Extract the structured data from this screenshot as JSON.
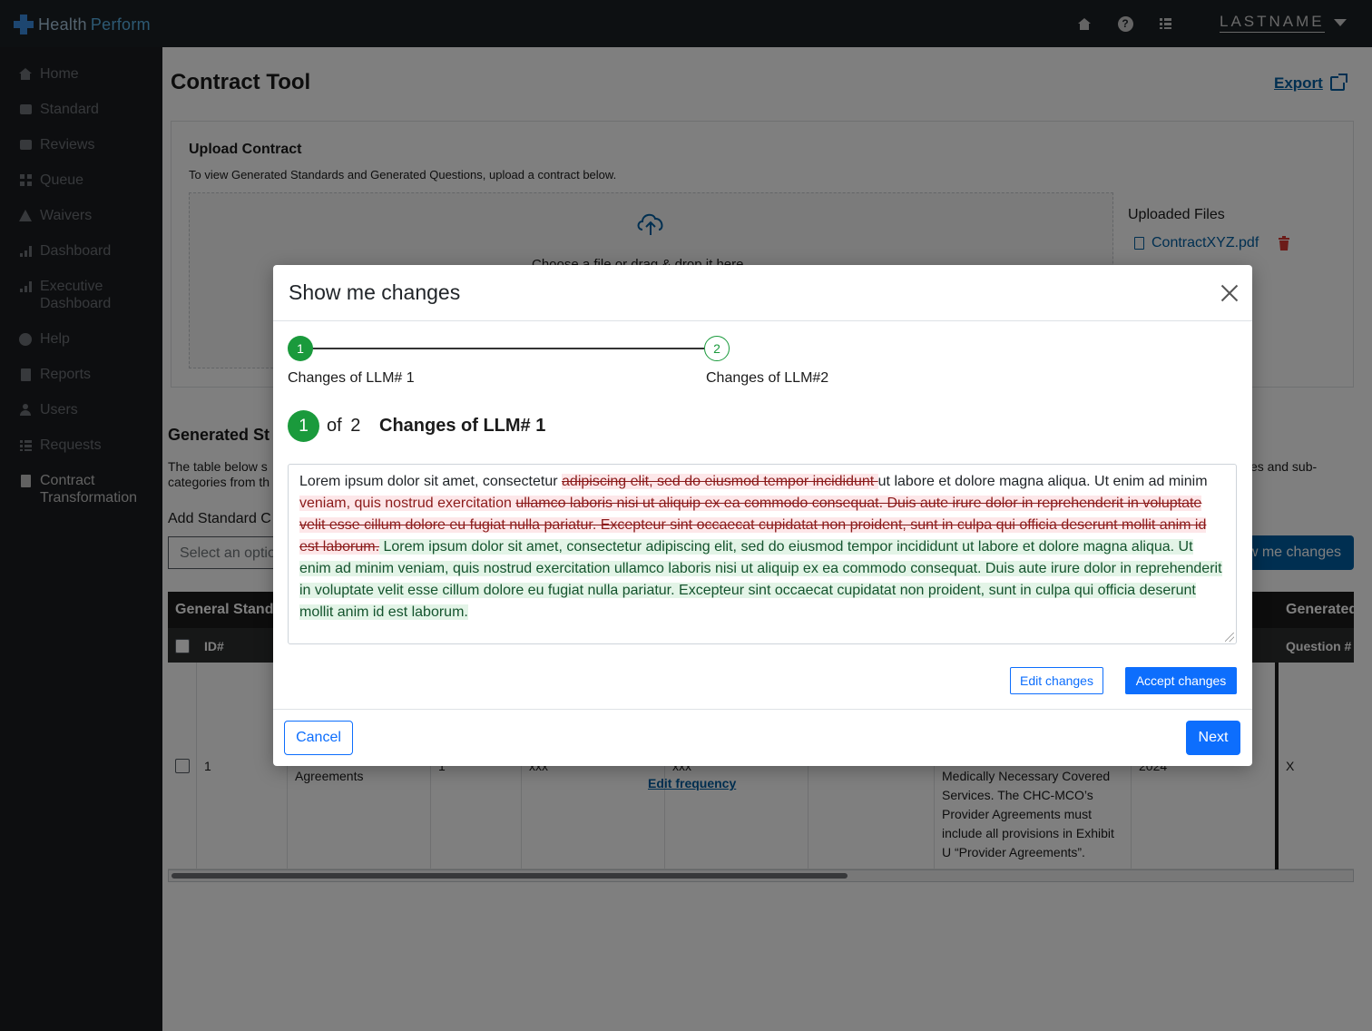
{
  "app": {
    "logo_part1": "Health",
    "logo_part2": "Perform",
    "user_name": "LASTNAME"
  },
  "topbar_icons": [
    "home-icon",
    "help-icon",
    "checklist-icon"
  ],
  "sidebar": {
    "items": [
      {
        "label": "Home",
        "icon": "home-icon"
      },
      {
        "label": "Standard",
        "icon": "book-icon"
      },
      {
        "label": "Reviews",
        "icon": "briefcase-icon"
      },
      {
        "label": "Queue",
        "icon": "grid-icon"
      },
      {
        "label": "Waivers",
        "icon": "warning-icon"
      },
      {
        "label": "Dashboard",
        "icon": "bar-chart-icon"
      },
      {
        "label": "Executive",
        "label2": "Dashboard",
        "icon": "bar-chart-icon"
      },
      {
        "label": "Help",
        "icon": "help-icon"
      },
      {
        "label": "Reports",
        "icon": "report-icon"
      },
      {
        "label": "Users",
        "icon": "user-icon"
      },
      {
        "label": "Requests",
        "icon": "list-icon"
      },
      {
        "label": "Contract",
        "label2": "Transformation",
        "icon": "document-icon",
        "active": true
      }
    ]
  },
  "page": {
    "title": "Contract Tool",
    "export_label": "Export"
  },
  "upload": {
    "title": "Upload Contract",
    "description": "To view Generated Standards and Generated Questions, upload a contract below.",
    "drop_text": "Choose a file or drag & drop it here",
    "uploaded_title": "Uploaded Files",
    "file_name": "ContractXYZ.pdf"
  },
  "generated": {
    "title": "Generated St",
    "desc_line1": "The table below s",
    "desc_line2": "categories from th",
    "desc_right1": "es and sub-",
    "add_standard_label": "Add Standard C",
    "select_placeholder": "Select an optio",
    "show_changes_label": "w me changes"
  },
  "table": {
    "group_left": "General Standa",
    "group_right": "Generated",
    "col_id": "ID#",
    "col_question": "Question #",
    "row": {
      "id": "1",
      "category": "Agreements",
      "col3": "1",
      "col4": "xxx",
      "col5": "xxx",
      "edit_frequency": "Edit frequency",
      "description_lines": [
        "Medically Necessary Covered",
        "Services. The CHC-MCO’s",
        "Provider Agreements must",
        "include all provisions in Exhibit",
        "U “Provider Agreements”."
      ],
      "year": "2024",
      "question": "X"
    }
  },
  "modal": {
    "title": "Show me changes",
    "steps": [
      {
        "number": "1",
        "label": "Changes of LLM# 1"
      },
      {
        "number": "2",
        "label": "Changes of LLM#2"
      }
    ],
    "current_step": "1",
    "of_text": "of 2",
    "step_heading": "Changes of LLM# 1",
    "diff": {
      "plain1": "Lorem ipsum dolor sit amet, consectetur ",
      "deleted1": "adipiscing elit, sed do eiusmod tempor incididunt ",
      "plain2": "ut labore et dolore magna aliqua. Ut enim ad minim ",
      "inserted_mid": "veniam, quis nostrud exercitation ",
      "deleted2": "ullamco laboris nisi ut aliquip ex ea commodo consequat. Duis aute irure dolor in reprehenderit in voluptate velit esse cillum dolore eu fugiat nulla pariatur. Excepteur sint occaecat cupidatat non proident, sunt in culpa qui officia deserunt mollit anim id est laborum.",
      "inserted": " Lorem ipsum dolor sit amet, consectetur adipiscing elit, sed do eiusmod tempor incididunt ut labore et dolore magna aliqua. Ut enim ad minim veniam, quis nostrud exercitation ullamco laboris nisi ut aliquip ex ea commodo consequat. Duis aute irure dolor in reprehenderit in voluptate velit esse cillum dolore eu fugiat nulla pariatur. Excepteur sint occaecat cupidatat non proident, sunt in culpa qui officia deserunt mollit anim id est laborum. "
    },
    "edit_changes_label": "Edit changes",
    "accept_changes_label": "Accept changes",
    "cancel_label": "Cancel",
    "next_label": "Next"
  },
  "colors": {
    "primary": "#0d6efd",
    "step_green": "#1a9a3c",
    "deleted_bg": "#fde7e9",
    "inserted_bg": "#e3f4e7",
    "topbar": "#1b2025",
    "sidebar": "#1b1d20"
  }
}
